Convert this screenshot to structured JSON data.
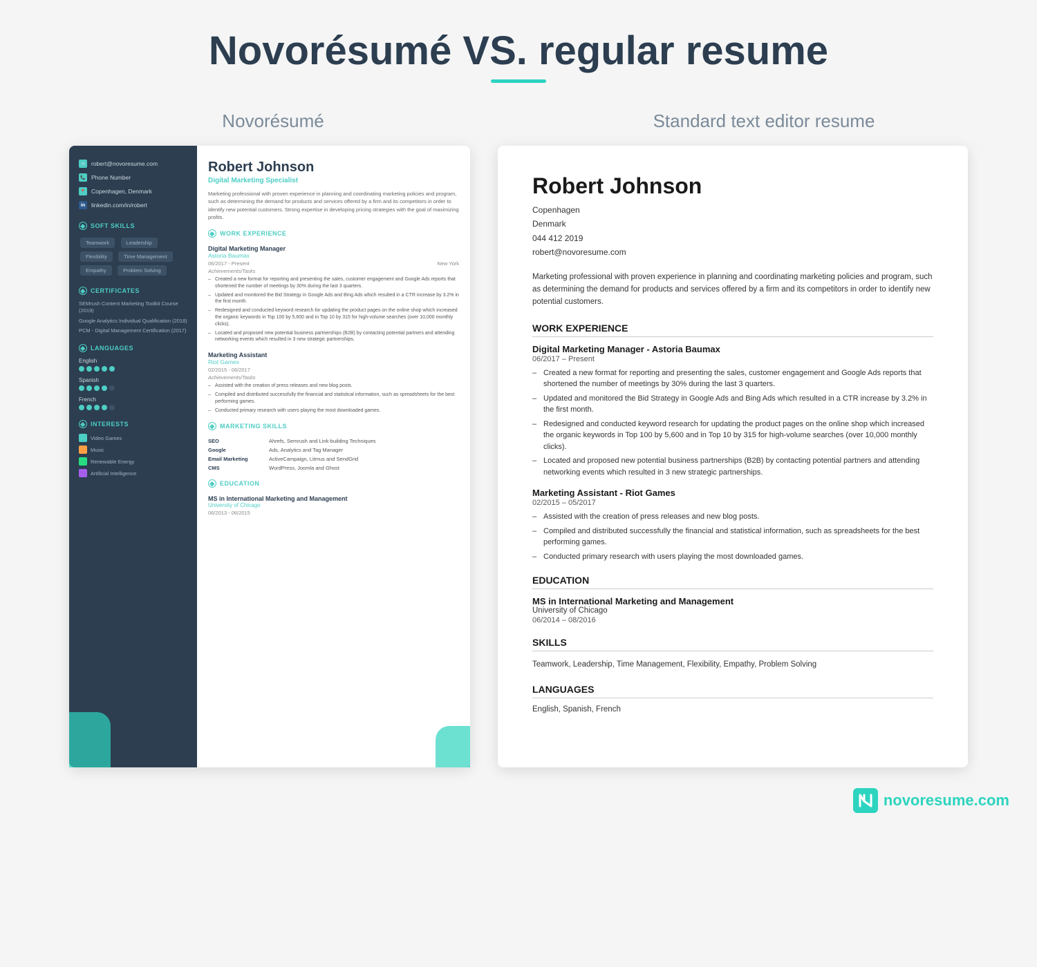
{
  "page": {
    "title": "Novorésumé VS. regular resume",
    "title_underline_color": "#2dd4bf",
    "left_heading": "Novorésumé",
    "right_heading": "Standard text editor resume"
  },
  "novoresume": {
    "sidebar": {
      "contact": {
        "email": "robert@novoresume.com",
        "phone": "Phone Number",
        "location": "Copenhagen, Denmark",
        "linkedin": "linkedin.com/in/robert"
      },
      "soft_skills_title": "SOFT SKILLS",
      "soft_skills": [
        "Teamwork",
        "Leadership",
        "Flexibility",
        "Time Management",
        "Empathy",
        "Problem Solving"
      ],
      "certificates_title": "CERTIFICATES",
      "certificates": [
        "SEMrush Content Marketing Toolkit Course (2019)",
        "Google Analytics Individual Qualification (2018)",
        "PCM - Digital Management Certification (2017)"
      ],
      "languages_title": "LANGUAGES",
      "languages": [
        {
          "name": "English",
          "dots": 5,
          "filled": 5
        },
        {
          "name": "Spanish",
          "dots": 5,
          "filled": 4
        },
        {
          "name": "French",
          "dots": 5,
          "filled": 4
        }
      ],
      "interests_title": "INTERESTS",
      "interests": [
        "Video Games",
        "Music",
        "Renewable Energy",
        "Artificial Intelligence"
      ]
    },
    "main": {
      "name": "Robert Johnson",
      "title": "Digital Marketing Specialist",
      "summary": "Marketing professional with proven experience in planning and coordinating marketing policies and program, such as determining the demand for products and services offered by a firm and its competitors in order to identify new potential customers. Strong expertise in developing pricing strategies with the goal of maximizing profits.",
      "work_experience_title": "WORK EXPERIENCE",
      "jobs": [
        {
          "title": "Digital Marketing Manager",
          "company": "Astoria Baumax",
          "dates": "06/2017 - Present",
          "location": "New York",
          "achievements_label": "Achievements/Tasks",
          "bullets": [
            "Created a new format for reporting and presenting the sales, customer engagement and Google Ads reports that shortened the number of meetings by 30% during the last 3 quarters.",
            "Updated and monitored the Bid Strategy in Google Ads and Bing Ads which resulted in a CTR increase by 3.2% in the first month.",
            "Redesigned and conducted keyword research for updating the product pages on the online shop which increased the organic keywords in Top 100 by 5,600 and in Top 10 by 315 for high-volume searches (over 10,000 monthly clicks).",
            "Located and proposed new potential business partnerships (B2B) by contacting potential partners and attending networking events which resulted in 3 new strategic partnerships."
          ]
        },
        {
          "title": "Marketing Assistant",
          "company": "Riot Games",
          "dates": "02/2015 - 06/2017",
          "location": "",
          "achievements_label": "Achievements/Tasks",
          "bullets": [
            "Assisted with the creation of press releases and new blog posts.",
            "Compiled and distributed successfully the financial and statistical information, such as spreadsheets for the best performing games.",
            "Conducted primary research with users playing the most downloaded games."
          ]
        }
      ],
      "marketing_skills_title": "MARKETING SKILLS",
      "marketing_skills": [
        {
          "label": "SEO",
          "value": "Ahrefs, Semrush and Link-building Techniques"
        },
        {
          "label": "Google",
          "value": "Ads, Analytics and Tag Manager"
        },
        {
          "label": "Email Marketing",
          "value": "ActiveCampaign, Litmus and SendGrid"
        },
        {
          "label": "CMS",
          "value": "WordPress, Joomla and Ghost"
        }
      ],
      "education_title": "EDUCATION",
      "education": [
        {
          "degree": "MS in International Marketing and Management",
          "school": "University of Chicago",
          "dates": "06/2013 - 06/2015"
        }
      ]
    }
  },
  "standard": {
    "name": "Robert Johnson",
    "contact": {
      "city": "Copenhagen",
      "country": "Denmark",
      "phone": "044 412 2019",
      "email": "robert@novoresume.com"
    },
    "summary": "Marketing professional with proven experience in planning and coordinating marketing policies and program, such as determining the demand for products and services offered by a firm and its competitors in order to identify new potential customers.",
    "work_experience_title": "WORK EXPERIENCE",
    "jobs": [
      {
        "title": "Digital Marketing Manager - Astoria Baumax",
        "dates": "06/2017 – Present",
        "bullets": [
          "Created a new format for reporting and presenting the sales, customer engagement and Google Ads reports that shortened the number of meetings by 30% during the last 3 quarters.",
          "Updated and monitored the Bid Strategy in Google Ads and Bing Ads which resulted in a CTR increase by 3.2% in the first month.",
          "Redesigned and conducted keyword research for updating the product pages on the online shop which increased the organic keywords in Top 100 by 5,600 and in Top 10 by 315 for high-volume searches (over 10,000 monthly clicks).",
          "Located and proposed new potential business partnerships (B2B) by contacting potential partners and attending networking events which resulted in 3 new strategic partnerships."
        ]
      },
      {
        "title": "Marketing Assistant - Riot Games",
        "dates": "02/2015 – 05/2017",
        "bullets": [
          "Assisted with the creation of press releases and new blog posts.",
          "Compiled and distributed successfully the financial and statistical information, such as spreadsheets for the best performing games.",
          "Conducted primary research with users playing the most downloaded games."
        ]
      }
    ],
    "education_title": "EDUCATION",
    "education": [
      {
        "degree": "MS in International Marketing and Management",
        "school": "University of Chicago",
        "dates": "06/2014 – 08/2016"
      }
    ],
    "skills_title": "SKILLS",
    "skills": "Teamwork, Leadership, Time Management, Flexibility, Empathy, Problem Solving",
    "languages_title": "LANGUAGES",
    "languages": "English, Spanish, French"
  },
  "footer": {
    "logo_letter": "N",
    "brand_text": "novoresume",
    "brand_domain": ".com"
  }
}
